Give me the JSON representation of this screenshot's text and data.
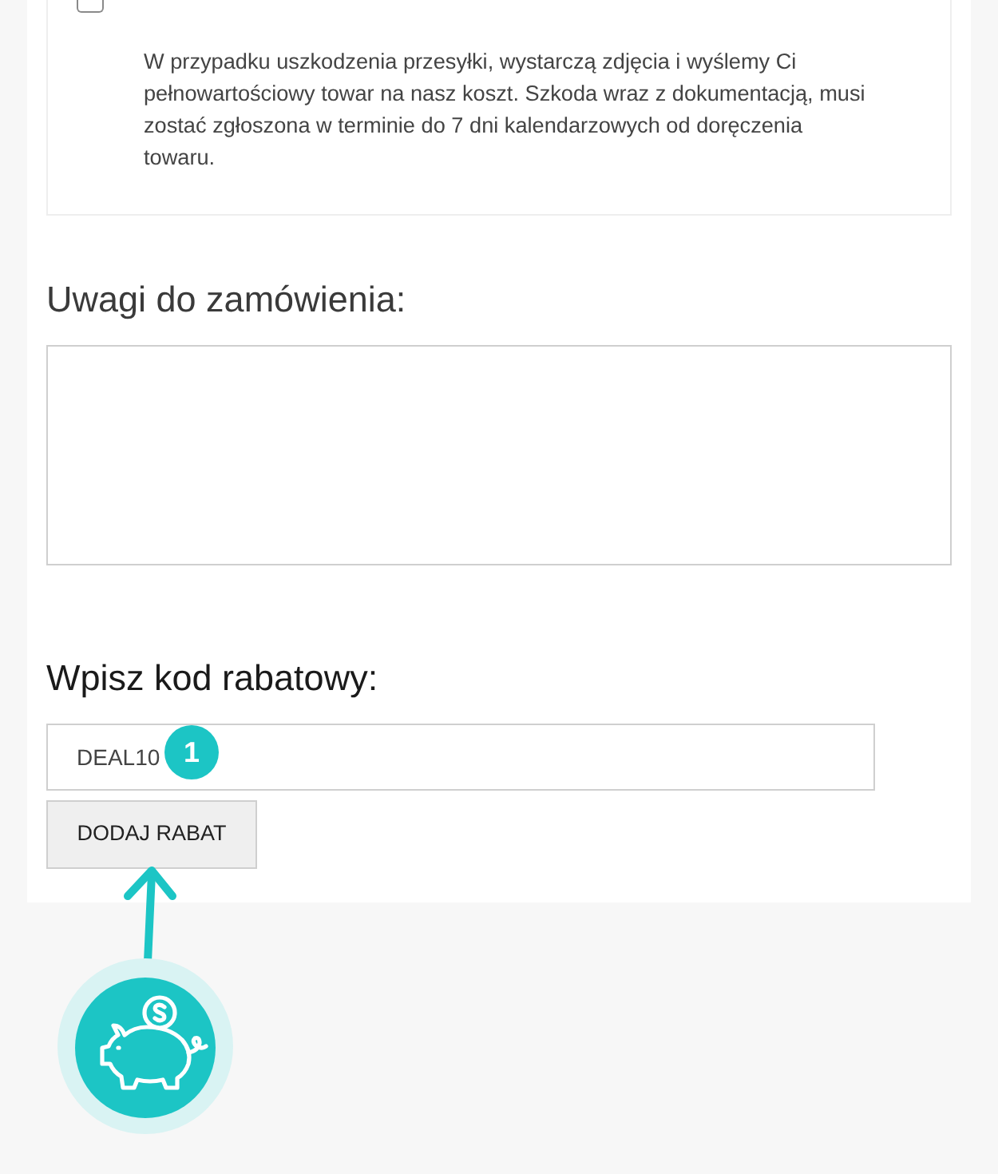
{
  "insurance_notice": {
    "checkbox": {
      "checked": false
    },
    "text": "W przypadku uszkodzenia przesyłki, wystarczą zdjęcia i wyślemy Ci pełnowartościowy towar na nasz koszt. Szkoda wraz z dokumentacją, musi zostać zgłoszona w terminie do 7 dni kalendarzowych od doręczenia towaru."
  },
  "order_notes": {
    "label": "Uwagi do zamówienia:"
  },
  "discount": {
    "label": "Wpisz kod rabatowy:",
    "code": {
      "value": "DEAL10"
    },
    "button": "DODAJ RABAT"
  },
  "annotation": {
    "step_badge": "1"
  }
}
